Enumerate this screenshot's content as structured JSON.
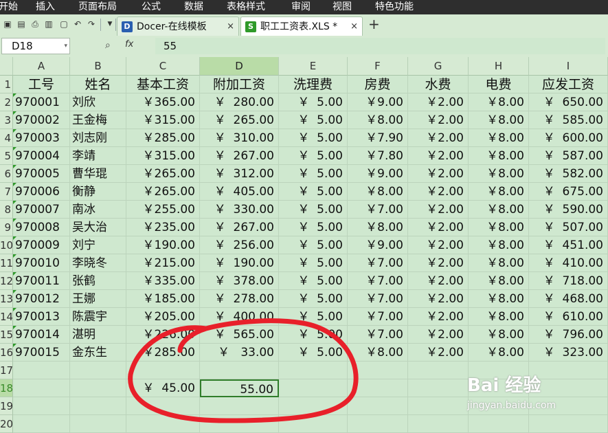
{
  "menu": [
    "开始",
    "插入",
    "页面布局",
    "公式",
    "数据",
    "表格样式",
    "审阅",
    "视图",
    "特色功能"
  ],
  "tabs": [
    {
      "label": "Docer-在线模板",
      "icon": "docer-icon",
      "close": "×",
      "active": false
    },
    {
      "label": "职工工资表.XLS *",
      "icon": "excel-file-icon",
      "close": "×",
      "active": true
    }
  ],
  "new_tab_symbol": "+",
  "quick_access": [
    "save-icon",
    "pdf-icon",
    "print-icon",
    "print-preview-icon",
    "page-setup-icon",
    "undo-icon",
    "redo-icon",
    "dropdown-icon"
  ],
  "formula_bar": {
    "cell_ref": "D18",
    "fx": "fx",
    "value": "55"
  },
  "columns": [
    "A",
    "B",
    "C",
    "D",
    "E",
    "F",
    "G",
    "H",
    "I"
  ],
  "selected_column": "D",
  "rows": [
    "1",
    "2",
    "3",
    "4",
    "5",
    "6",
    "7",
    "8",
    "9",
    "10",
    "11",
    "12",
    "13",
    "14",
    "15",
    "16",
    "17",
    "18",
    "19",
    "20"
  ],
  "selected_row": "18",
  "headers": [
    "工号",
    "姓名",
    "基本工资",
    "附加工资",
    "洗理费",
    "房费",
    "水费",
    "电费",
    "应发工资"
  ],
  "records": [
    [
      "970001",
      "刘欣",
      "￥365.00",
      "￥  280.00",
      "￥  5.00",
      "￥9.00",
      "￥2.00",
      "￥8.00",
      "￥  650.00"
    ],
    [
      "970002",
      "王金梅",
      "￥315.00",
      "￥  265.00",
      "￥  5.00",
      "￥8.00",
      "￥2.00",
      "￥8.00",
      "￥  585.00"
    ],
    [
      "970003",
      "刘志刚",
      "￥285.00",
      "￥  310.00",
      "￥  5.00",
      "￥7.90",
      "￥2.00",
      "￥8.00",
      "￥  600.00"
    ],
    [
      "970004",
      "李靖",
      "￥315.00",
      "￥  267.00",
      "￥  5.00",
      "￥7.80",
      "￥2.00",
      "￥8.00",
      "￥  587.00"
    ],
    [
      "970005",
      "曹华琨",
      "￥265.00",
      "￥  312.00",
      "￥  5.00",
      "￥9.00",
      "￥2.00",
      "￥8.00",
      "￥  582.00"
    ],
    [
      "970006",
      "衡静",
      "￥265.00",
      "￥  405.00",
      "￥  5.00",
      "￥8.00",
      "￥2.00",
      "￥8.00",
      "￥  675.00"
    ],
    [
      "970007",
      "南冰",
      "￥255.00",
      "￥  330.00",
      "￥  5.00",
      "￥7.00",
      "￥2.00",
      "￥8.00",
      "￥  590.00"
    ],
    [
      "970008",
      "吴大治",
      "￥235.00",
      "￥  267.00",
      "￥  5.00",
      "￥8.00",
      "￥2.00",
      "￥8.00",
      "￥  507.00"
    ],
    [
      "970009",
      "刘宁",
      "￥190.00",
      "￥  256.00",
      "￥  5.00",
      "￥9.00",
      "￥2.00",
      "￥8.00",
      "￥  451.00"
    ],
    [
      "970010",
      "李晓冬",
      "￥215.00",
      "￥  190.00",
      "￥  5.00",
      "￥7.00",
      "￥2.00",
      "￥8.00",
      "￥  410.00"
    ],
    [
      "970011",
      "张鹤",
      "￥335.00",
      "￥  378.00",
      "￥  5.00",
      "￥7.00",
      "￥2.00",
      "￥8.00",
      "￥  718.00"
    ],
    [
      "970012",
      "王娜",
      "￥185.00",
      "￥  278.00",
      "￥  5.00",
      "￥7.00",
      "￥2.00",
      "￥8.00",
      "￥  468.00"
    ],
    [
      "970013",
      "陈震宇",
      "￥205.00",
      "￥  400.00",
      "￥  5.00",
      "￥7.00",
      "￥2.00",
      "￥8.00",
      "￥  610.00"
    ],
    [
      "970014",
      "湛明",
      "￥226.00",
      "￥  565.00",
      "￥  5.00",
      "￥7.00",
      "￥2.00",
      "￥8.00",
      "￥  796.00"
    ],
    [
      "970015",
      "金东生",
      "￥285.00",
      "￥   33.00",
      "￥  5.00",
      "￥8.00",
      "￥2.00",
      "￥8.00",
      "￥  323.00"
    ]
  ],
  "row18": {
    "C": "￥  45.00",
    "D": "55.00"
  },
  "colors": {
    "sheet_bg": "#cfe8cf",
    "selection": "#2f7d2a",
    "annotation": "#e8202a",
    "menubar": "#2e2e2e"
  },
  "watermark": {
    "logo": "Bai 经验",
    "url": "jingyan.baidu.com"
  }
}
